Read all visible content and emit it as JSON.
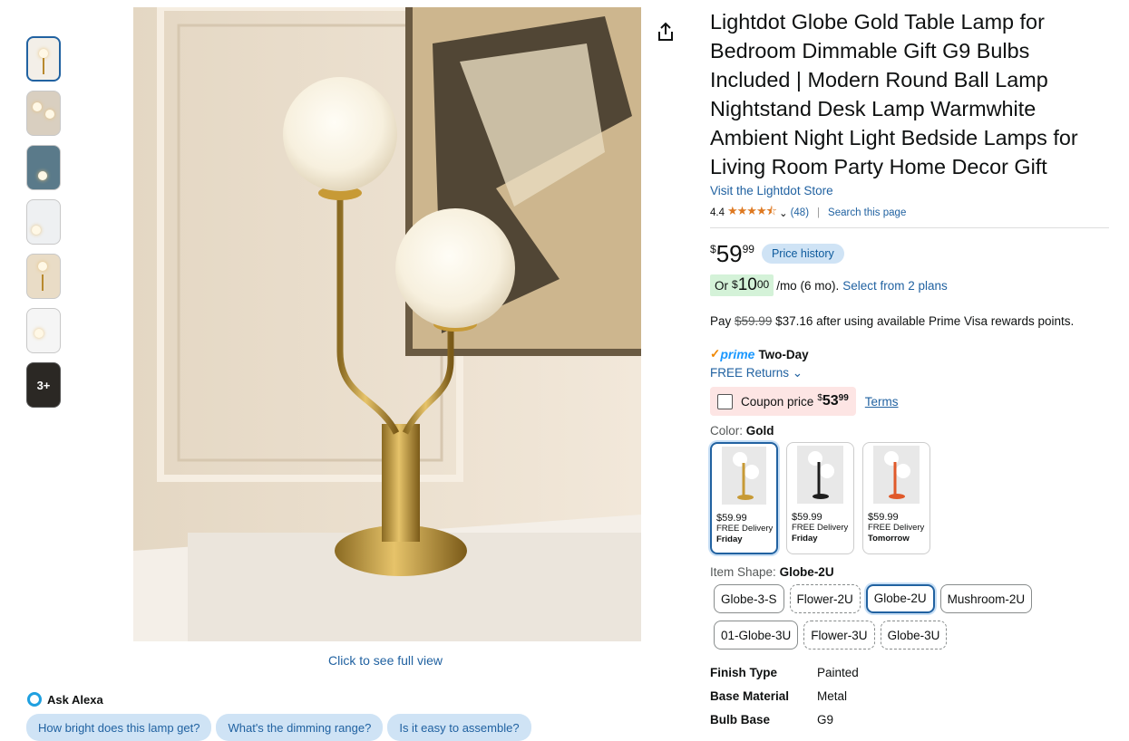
{
  "thumbnails": [
    "thumb-1",
    "thumb-2",
    "thumb-3",
    "thumb-4",
    "thumb-5",
    "thumb-6"
  ],
  "more_thumbs_label": "3+",
  "full_view_label": "Click to see full view",
  "alexa": {
    "label": "Ask Alexa",
    "chips": [
      "How bright does this lamp get?",
      "What's the dimming range?",
      "Is it easy to assemble?"
    ]
  },
  "product": {
    "title": "Lightdot Globe Gold Table Lamp for Bedroom Dimmable Gift G9 Bulbs Included | Modern Round Ball Lamp Nightstand Desk Lamp Warmwhite Ambient Night Light Bedside Lamps for Living Room Party Home Decor Gift",
    "store_link": "Visit the Lightdot Store",
    "rating_value": "4.4",
    "stars": "★★★★⯪",
    "review_count": "(48)",
    "search_page": "Search this page",
    "price_dollars": "59",
    "price_cents": "99",
    "price_symbol": "$",
    "price_history": "Price history",
    "monthly": {
      "prefix": "Or",
      "dollars": "10",
      "cents": "00",
      "suffix": "/mo (6 mo).",
      "plans_link": "Select from 2 plans"
    },
    "pay": {
      "prefix": "Pay",
      "old": "$59.99",
      "new": "$37.16",
      "suffix": "after using available Prime Visa rewards points."
    },
    "prime": {
      "logo": "prime",
      "speed": "Two-Day"
    },
    "returns": "FREE Returns",
    "coupon": {
      "label": "Coupon price",
      "dollars": "53",
      "cents": "99",
      "terms": "Terms"
    },
    "color": {
      "label": "Color:",
      "value": "Gold"
    },
    "swatches": [
      {
        "price": "$59.99",
        "delivery": "FREE Delivery",
        "day": "Friday",
        "accent": "#c79a36"
      },
      {
        "price": "$59.99",
        "delivery": "FREE Delivery",
        "day": "Friday",
        "accent": "#1e1e1e"
      },
      {
        "price": "$59.99",
        "delivery": "FREE Delivery",
        "day": "Tomorrow",
        "accent": "#e0592a"
      }
    ],
    "shape": {
      "label": "Item Shape:",
      "value": "Globe-2U"
    },
    "shapes": [
      "Globe-3-S",
      "Flower-2U",
      "Globe-2U",
      "Mushroom-2U",
      "01-Globe-3U",
      "Flower-3U",
      "Globe-3U"
    ],
    "specs": [
      {
        "key": "Finish Type",
        "value": "Painted"
      },
      {
        "key": "Base Material",
        "value": "Metal"
      },
      {
        "key": "Bulb Base",
        "value": "G9"
      }
    ]
  }
}
